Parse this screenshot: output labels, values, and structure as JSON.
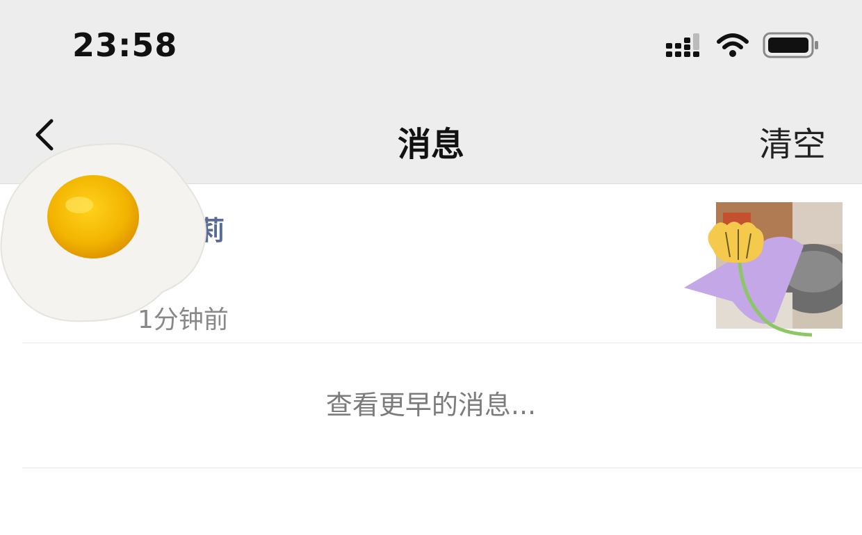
{
  "status_bar": {
    "time": "23:58",
    "icons": [
      "signal-icon",
      "wifi-icon",
      "battery-icon"
    ]
  },
  "nav": {
    "back_icon": "chevron-left-icon",
    "title": "消息",
    "clear_label": "清空"
  },
  "message": {
    "sender_partial": "莉",
    "time": "1分钟前"
  },
  "footer": {
    "view_earlier": "查看更早的消息..."
  },
  "colors": {
    "background_top": "#ededed",
    "link_name": "#576b95",
    "muted_text": "#888888"
  },
  "stickers": [
    "fried-egg-sticker",
    "flower-sticker"
  ]
}
